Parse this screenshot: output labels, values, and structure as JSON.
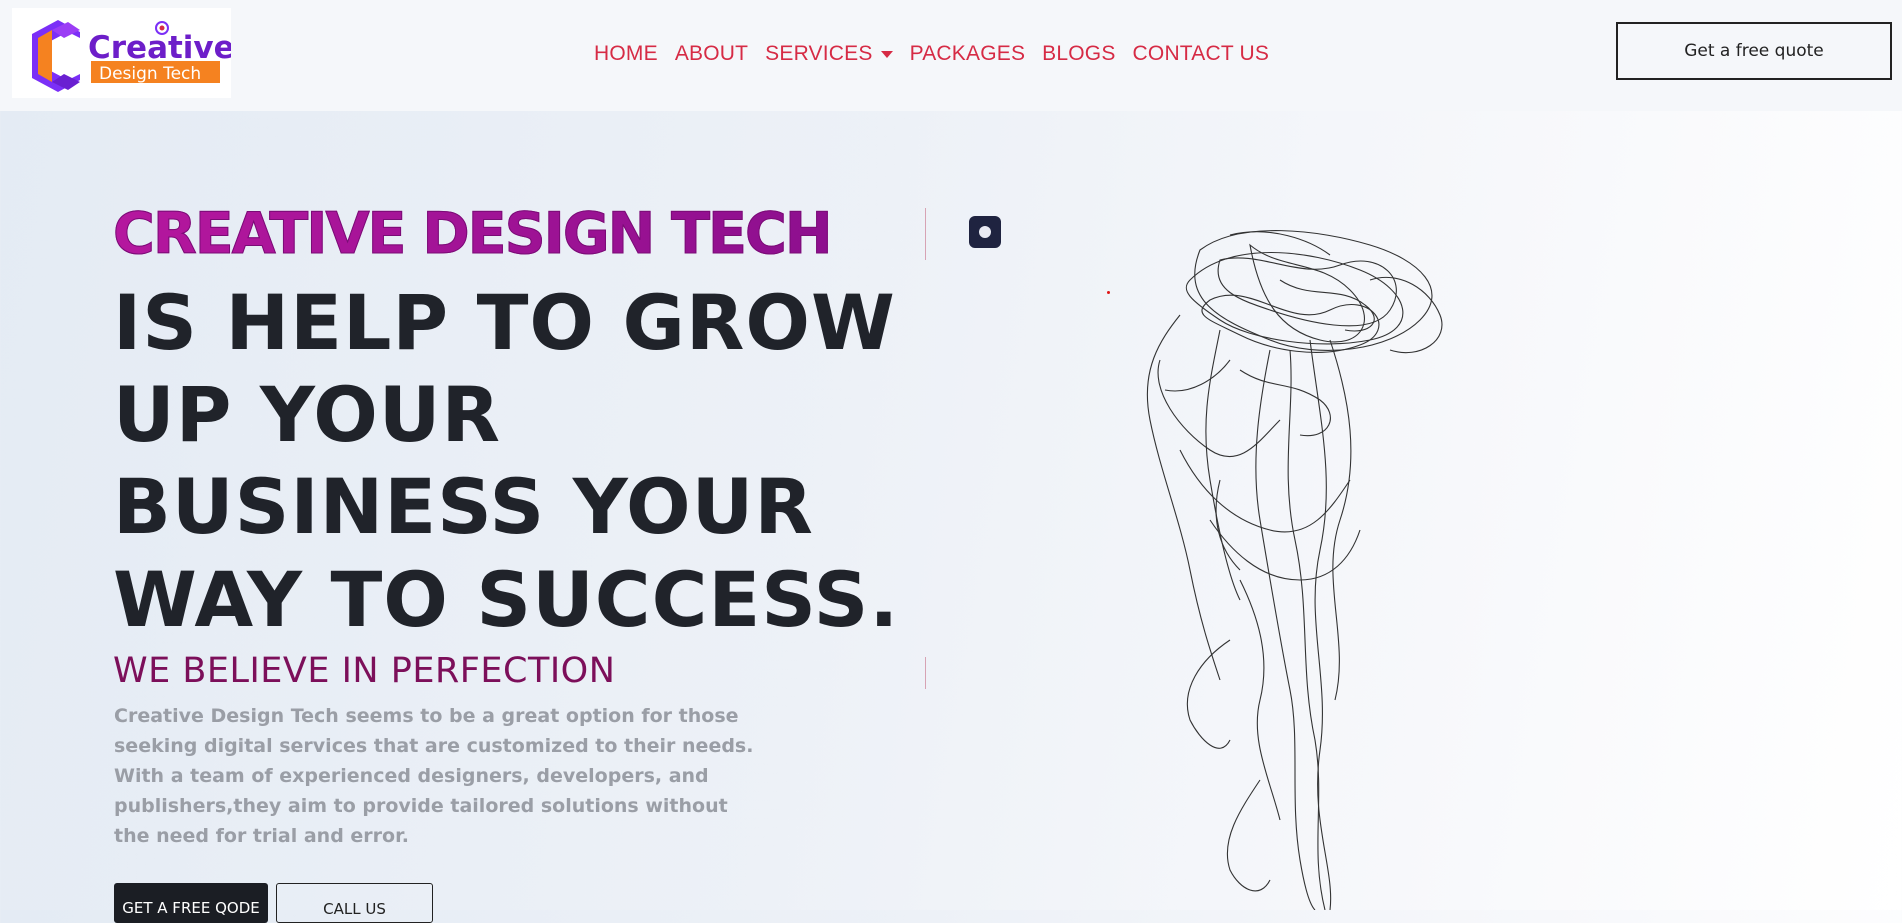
{
  "header": {
    "logo": {
      "word1": "Creative",
      "word2": "Design Tech"
    },
    "nav": [
      {
        "label": "HOME"
      },
      {
        "label": "ABOUT"
      },
      {
        "label": "SERVICES",
        "has_dropdown": true
      },
      {
        "label": "PACKAGES"
      },
      {
        "label": "BLOGS"
      },
      {
        "label": "CONTACT US"
      }
    ],
    "quote_button": "Get a free quote"
  },
  "hero": {
    "brand": "CREATIVE DESIGN TECH",
    "headline": [
      "IS HELP TO GROW",
      "UP YOUR",
      "BUSINESS YOUR",
      "WAY TO SUCCESS."
    ],
    "subheading": "WE BELIEVE IN PERFECTION",
    "description": "Creative Design Tech seems to be a great option for those seeking digital services that are customized to their needs. With a team of experienced designers, developers, and publishers,they aim to provide tailored solutions without the need for trial and error.",
    "cta_primary": "GET A FREE QODE",
    "cta_secondary": "CALL US"
  },
  "colors": {
    "nav": "#d62b45",
    "brand_gradient": "#b5179e",
    "headline": "#20232a",
    "subheading": "#7c0f5a",
    "body": "#9a9ea6"
  },
  "icons": {
    "control": "brain-icon",
    "illustration": "line-sketch-head-illustration"
  }
}
